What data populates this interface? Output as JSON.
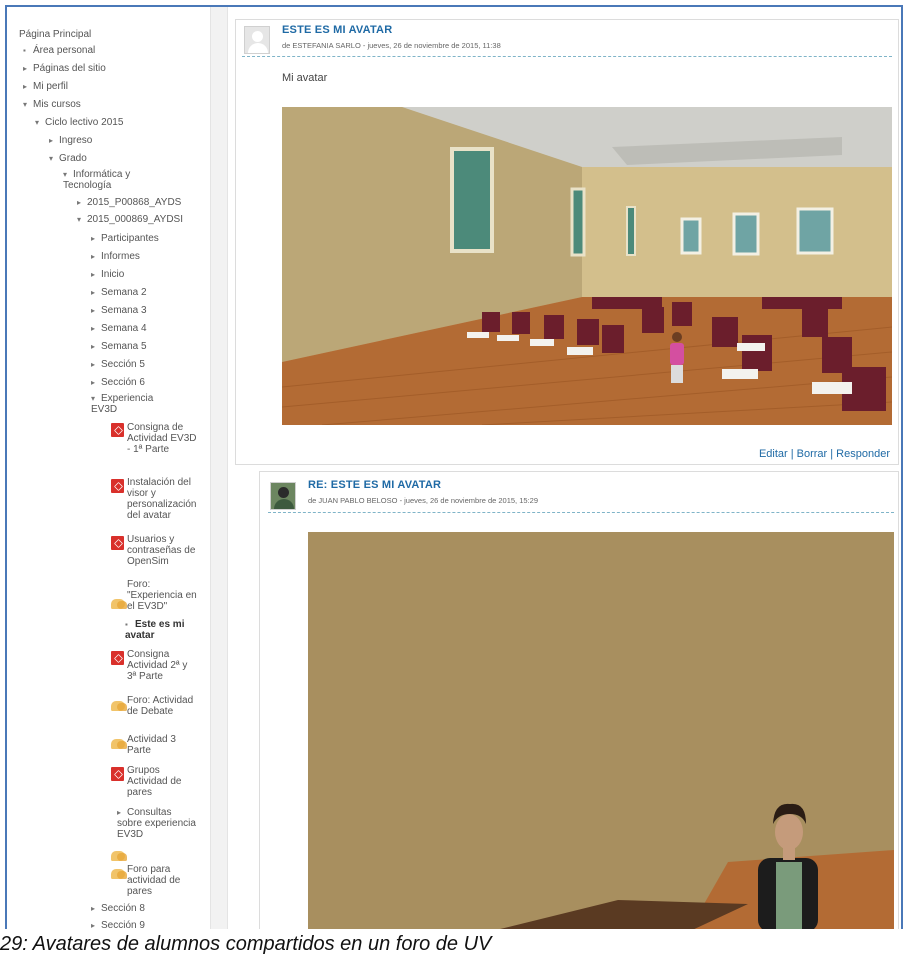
{
  "sidebar": {
    "items": [
      {
        "label": "Página Principal"
      },
      {
        "label": "Área personal"
      },
      {
        "label": "Páginas del sitio"
      },
      {
        "label": "Mi perfil"
      },
      {
        "label": "Mis cursos"
      },
      {
        "label": "Ciclo lectivo 2015"
      },
      {
        "label": "Ingreso"
      },
      {
        "label": "Grado"
      },
      {
        "label": "Informática y Tecnología"
      },
      {
        "label": "2015_P00868_AYDS"
      },
      {
        "label": "2015_000869_AYDSI"
      },
      {
        "label": "Participantes"
      },
      {
        "label": "Informes"
      },
      {
        "label": "Inicio"
      },
      {
        "label": "Semana 2"
      },
      {
        "label": "Semana 3"
      },
      {
        "label": "Semana 4"
      },
      {
        "label": "Semana 5"
      },
      {
        "label": "Sección 5"
      },
      {
        "label": "Sección 6"
      },
      {
        "label": "Experiencia EV3D"
      },
      {
        "label": "Consigna de Actividad EV3D - 1ª Parte"
      },
      {
        "label": "Instalación del visor y personalización del avatar"
      },
      {
        "label": "Usuarios y contraseñas de OpenSim"
      },
      {
        "label": "Foro: \"Experiencia en el EV3D\""
      },
      {
        "label": "Este es mi avatar"
      },
      {
        "label": "Consigna Actividad 2ª y 3ª Parte"
      },
      {
        "label": "Foro: Actividad de Debate"
      },
      {
        "label": "Actividad 3 Parte"
      },
      {
        "label": "Grupos Actividad de pares"
      },
      {
        "label": "Consultas sobre experiencia EV3D"
      },
      {
        "label": "Foro para actividad de pares"
      },
      {
        "label": "Sección 8"
      },
      {
        "label": "Sección 9"
      }
    ]
  },
  "posts": [
    {
      "title": "ESTE ES MI AVATAR",
      "meta": "de ESTEFANIA SARLO - jueves, 26 de noviembre de 2015, 11:38",
      "text": "Mi avatar",
      "actions": "Editar | Borrar | Responder"
    },
    {
      "title": "RE: ESTE ES MI AVATAR",
      "meta": "de JUAN PABLO BELOSO - jueves, 26 de noviembre de 2015, 15:29"
    }
  ],
  "caption": "29: Avatares de alumnos compartidos en un foro de UV",
  "colors": {
    "accent": "#1f6aa5",
    "frame": "#4a78b8",
    "pdf": "#d9302b",
    "forum": "#f1c46a"
  }
}
